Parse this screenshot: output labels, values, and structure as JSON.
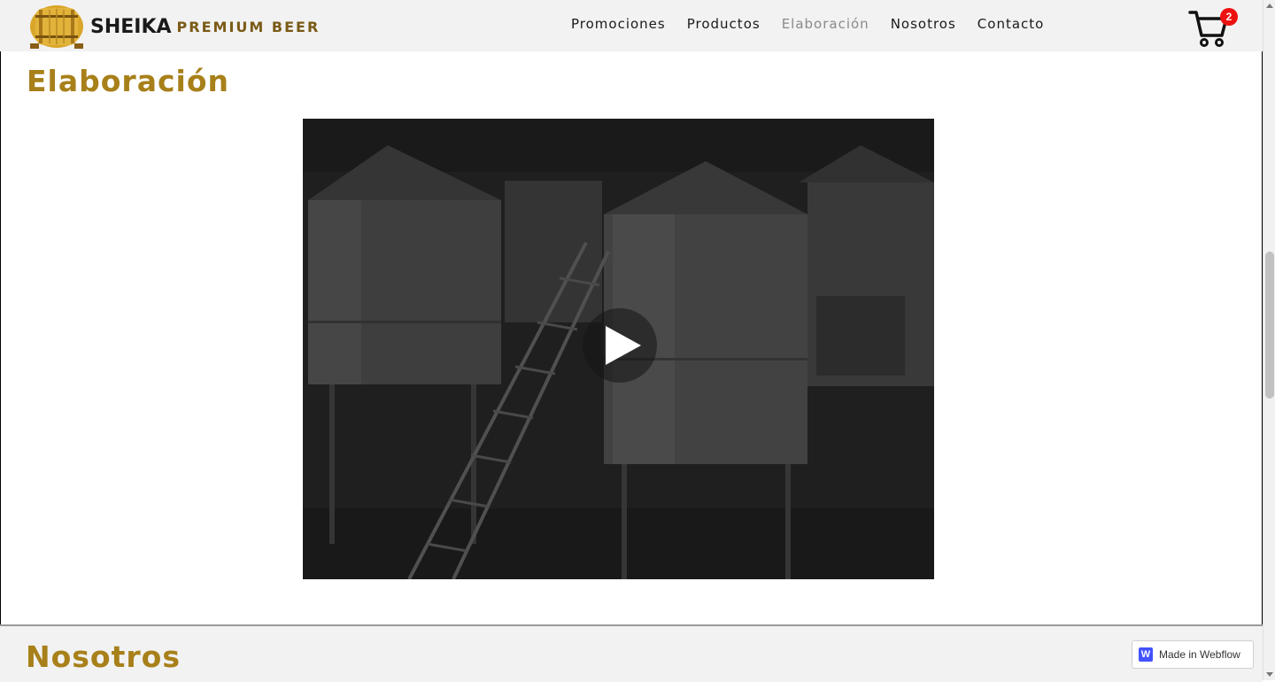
{
  "header": {
    "brand": "SHEIKA",
    "tagline": "PREMIUM BEER",
    "nav": [
      {
        "label": "Promociones",
        "active": false
      },
      {
        "label": "Productos",
        "active": false
      },
      {
        "label": "Elaboración",
        "active": true
      },
      {
        "label": "Nosotros",
        "active": false
      },
      {
        "label": "Contacto",
        "active": false
      }
    ],
    "cart": {
      "icon": "shopping-cart-icon",
      "count": "2"
    }
  },
  "main": {
    "title": "Elaboración",
    "video": {
      "icon": "play-icon"
    }
  },
  "next_section": {
    "title": "Nosotros"
  },
  "badge": {
    "label": "Made in Webflow",
    "icon": "webflow-icon"
  },
  "colors": {
    "accent": "#a8801a",
    "header_bg": "#f2f2f2",
    "badge_red": "#ee1111"
  }
}
